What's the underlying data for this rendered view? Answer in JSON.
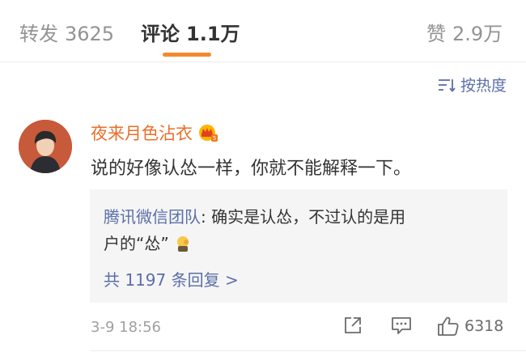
{
  "tabs": {
    "repost": {
      "label": "转发",
      "count": "3625"
    },
    "comments": {
      "label": "评论",
      "count": "1.1万"
    },
    "likes": {
      "label": "赞",
      "count": "2.9万"
    }
  },
  "sort": {
    "label": "按热度",
    "icon": "sort-icon"
  },
  "comment": {
    "username": "夜来月色沾衣",
    "badge_icon": "crown-vip-icon",
    "text": "说的好像认怂一样，你就不能解释一下。",
    "time": "3-9 18:56",
    "like_count": "6318",
    "reply": {
      "author": "腾讯微信团队",
      "line1": ": 确实是认怂，不过认的是用",
      "line2": "户的“怂”",
      "emoji_icon": "facepalm-emoji-icon",
      "more_label": "共 1197 条回复 >"
    }
  },
  "colors": {
    "accent": "#f48a2c",
    "username": "#e86f2a",
    "link": "#5b6fa8",
    "muted": "#939393"
  }
}
